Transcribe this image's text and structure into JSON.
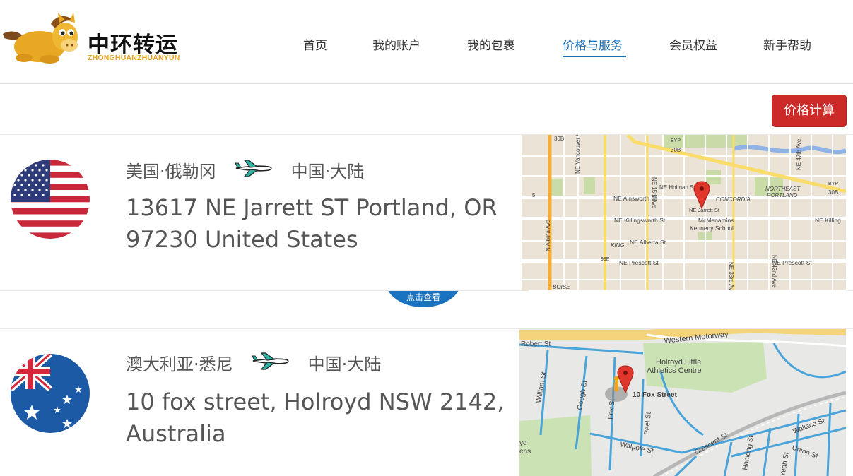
{
  "brand": {
    "name_cn": "中环转运",
    "name_en": "ZHONGHUANZHUANYUN"
  },
  "nav": {
    "items": [
      {
        "label": "首页",
        "active": false
      },
      {
        "label": "我的账户",
        "active": false
      },
      {
        "label": "我的包裹",
        "active": false
      },
      {
        "label": "价格与服务",
        "active": true
      },
      {
        "label": "会员权益",
        "active": false
      },
      {
        "label": "新手帮助",
        "active": false
      }
    ]
  },
  "toolbar": {
    "calc_label": "价格计算"
  },
  "colors": {
    "accent_blue": "#1a6fb5",
    "button_red": "#cc2a28",
    "logo_gold": "#e5a21f"
  },
  "cards": [
    {
      "flag": "us-flag",
      "origin": "美国·俄勒冈",
      "destination": "中国·大陆",
      "address": "13617 NE Jarrett ST Portland, OR 97230 United States",
      "map": {
        "labels": [
          "30B",
          "NE Vancouver Ave",
          "NE 15th Ave",
          "BYP",
          "30B",
          "NE 47th Ave",
          "5",
          "NE Holman St",
          "NE Ainsworth St",
          "NE Jarrett St",
          "CONCORDIA",
          "NORTHEAST",
          "PORTLAND",
          "NE Killingsworth St",
          "McMenamins",
          "Kennedy School",
          "N Albina Ave",
          "KING",
          "NE Alberta St",
          "NE 42nd Ave",
          "NE Killing",
          "99E",
          "NE Prescott St",
          "NE 33rd Ave",
          "NE Prescott St",
          "BOISE",
          "BYP",
          "30B"
        ]
      }
    },
    {
      "flag": "au-flag",
      "origin": "澳大利亚·悉尼",
      "destination": "中国·大陆",
      "address": "10 fox street, Holroyd NSW 2142, Australia",
      "map": {
        "labels": [
          "Western Motorway",
          "Robert St",
          "Holroyd Little",
          "Athletics Centre",
          "William St",
          "Gough St",
          "Fox St",
          "10 Fox Street",
          "Peel St",
          "Wallace St",
          "Crescent St",
          "Walpole St",
          "Union St",
          "Hanlong St",
          "Yeah St",
          "yd",
          "ens"
        ]
      }
    }
  ],
  "view_tab": {
    "label": "点击查看"
  }
}
